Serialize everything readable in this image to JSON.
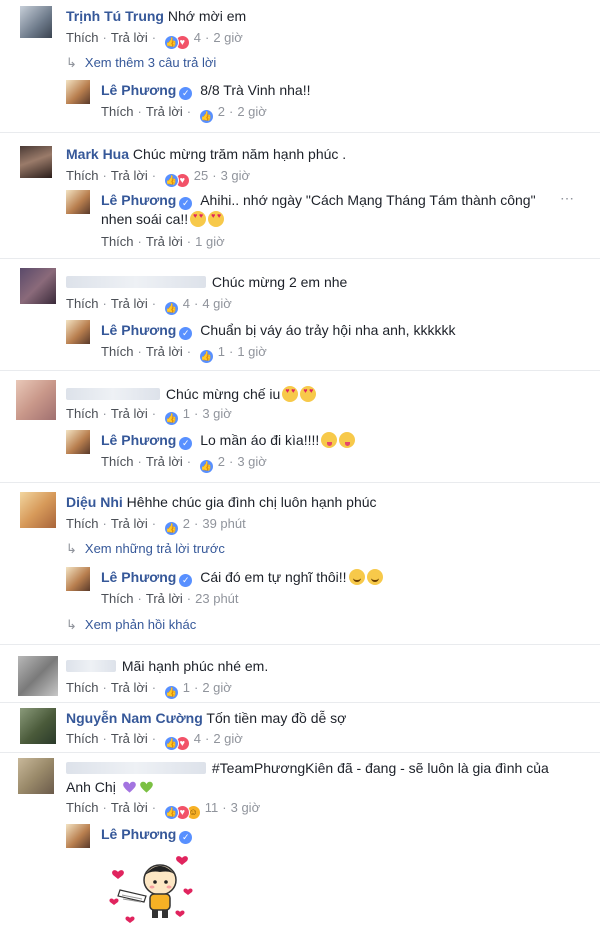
{
  "comments": [
    {
      "author": "Trịnh Tú Trung",
      "text": "Nhớ mời em",
      "like": "Thích",
      "reply": "Trả lời",
      "reactions": [
        "like",
        "love"
      ],
      "count": "4",
      "time": "2 giờ"
    },
    {
      "more": "Xem thêm 3 câu trả lời"
    },
    {
      "author": "Lê Phương",
      "text": "8/8 Trà Vinh nha!!",
      "like": "Thích",
      "reply": "Trả lời",
      "reactions": [
        "like"
      ],
      "count": "2",
      "time": "2 giờ"
    },
    {
      "author": "Mark Hua",
      "text": "Chúc mừng trăm năm hạnh phúc .",
      "like": "Thích",
      "reply": "Trả lời",
      "reactions": [
        "like",
        "love"
      ],
      "count": "25",
      "time": "3 giờ"
    },
    {
      "author": "Lê Phương",
      "text1": "Ahihi.. nhớ ngày \"Cách Mạng Tháng Tám thành công\"",
      "text2": "nhen soái ca!!",
      "like": "Thích",
      "reply": "Trả lời",
      "time": "1 giờ"
    },
    {
      "text": "Chúc mừng 2 em nhe",
      "like": "Thích",
      "reply": "Trả lời",
      "reactions": [
        "like"
      ],
      "count": "4",
      "time": "4 giờ"
    },
    {
      "author": "Lê Phương",
      "text": "Chuẩn bị váy áo trảy hội nha anh, kkkkkk",
      "like": "Thích",
      "reply": "Trả lời",
      "reactions": [
        "like"
      ],
      "count": "1",
      "time": "1 giờ"
    },
    {
      "text": "Chúc mừng chế iu",
      "like": "Thích",
      "reply": "Trả lời",
      "reactions": [
        "like"
      ],
      "count": "1",
      "time": "3 giờ"
    },
    {
      "author": "Lê Phương",
      "text": "Lo mần áo đi kìa!!!!",
      "like": "Thích",
      "reply": "Trả lời",
      "reactions": [
        "like"
      ],
      "count": "2",
      "time": "3 giờ"
    },
    {
      "author": "Diệu Nhi",
      "text": "Hêhhe chúc gia đình chị luôn hạnh phúc",
      "like": "Thích",
      "reply": "Trả lời",
      "reactions": [
        "like"
      ],
      "count": "2",
      "time": "39 phút"
    },
    {
      "more": "Xem những trả lời trước"
    },
    {
      "author": "Lê Phương",
      "text": "Cái đó em tự nghĩ thôi!!",
      "like": "Thích",
      "reply": "Trả lời",
      "time": "23 phút"
    },
    {
      "more": "Xem phản hồi khác"
    },
    {
      "text": "Mãi hạnh phúc nhé em.",
      "like": "Thích",
      "reply": "Trả lời",
      "reactions": [
        "like"
      ],
      "count": "1",
      "time": "2 giờ"
    },
    {
      "author": "Nguyễn Nam Cường",
      "text": "Tốn tiền may đồ dễ sợ",
      "like": "Thích",
      "reply": "Trả lời",
      "reactions": [
        "like",
        "love"
      ],
      "count": "4",
      "time": "2 giờ"
    },
    {
      "text1": "#TeamPhươngKiên đã - đang - sẽ luôn là gia đình của",
      "text2": "Anh Chị",
      "like": "Thích",
      "reply": "Trả lời",
      "reactions": [
        "like",
        "love",
        "haha"
      ],
      "count": "11",
      "time": "3 giờ"
    },
    {
      "author": "Lê Phương"
    }
  ],
  "colors": {
    "name": "#365899",
    "meta": "#90949c",
    "like": "#5890ff",
    "love": "#f25268"
  }
}
